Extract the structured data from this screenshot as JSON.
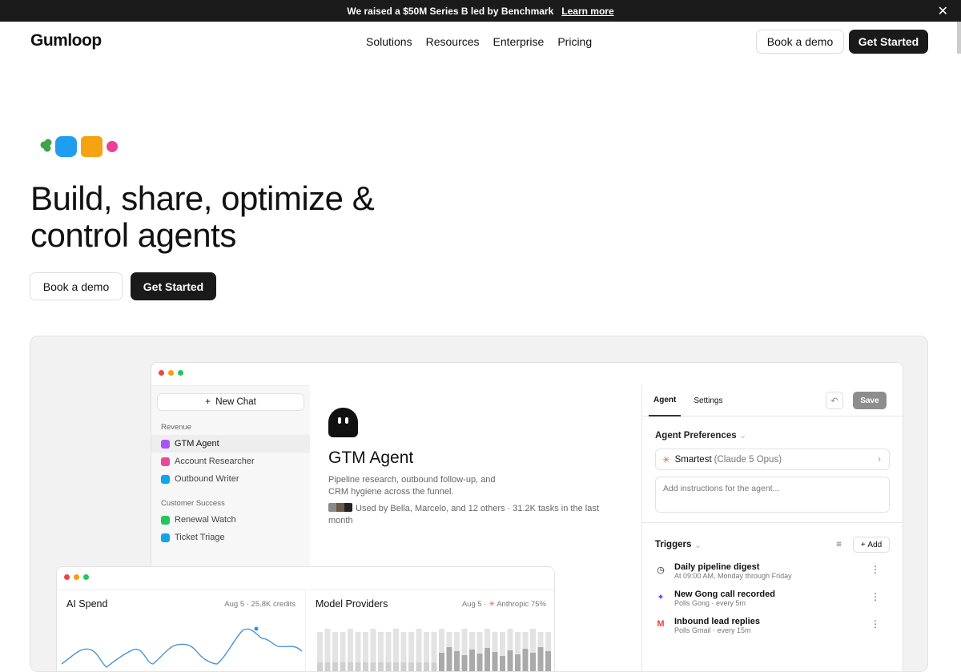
{
  "banner": {
    "text": "We raised a $50M Series B led by Benchmark",
    "link": "Learn more",
    "close": "✕"
  },
  "nav": {
    "logo": "Gumloop",
    "links": [
      "Solutions",
      "Resources",
      "Enterprise",
      "Pricing"
    ],
    "book_demo": "Book a demo",
    "get_started": "Get Started"
  },
  "hero": {
    "line1": "Build, share, optimize &",
    "line2": "control agents",
    "book_demo": "Book a demo",
    "get_started": "Get Started"
  },
  "app": {
    "new_chat": "New Chat",
    "groups": [
      {
        "label": "Revenue",
        "items": [
          {
            "label": "GTM Agent",
            "color": "#a855f7"
          },
          {
            "label": "Account Researcher",
            "color": "#ec4899"
          },
          {
            "label": "Outbound Writer",
            "color": "#0ea5e9"
          }
        ]
      },
      {
        "label": "Customer Success",
        "items": [
          {
            "label": "Renewal Watch",
            "color": "#22c55e"
          },
          {
            "label": "Ticket Triage",
            "color": "#0ea5e9"
          }
        ]
      }
    ],
    "agent": {
      "title": "GTM Agent",
      "desc": "Pipeline research, outbound follow-up, and CRM hygiene across the funnel.",
      "used": "Used by Bella, Marcelo, and 12 others · 31.2K tasks in the last month"
    },
    "tabs": [
      "Agent",
      "Settings"
    ],
    "save": "Save",
    "prefs": {
      "title": "Agent Preferences",
      "model_name": "Smartest",
      "model_detail": "(Claude 5 Opus)",
      "placeholder": "Add instructions for the agent..."
    },
    "triggers": {
      "title": "Triggers",
      "add": "Add",
      "items": [
        {
          "name": "Daily pipeline digest",
          "sub": "At 09:00 AM, Monday through Friday",
          "icon": "clock-icon"
        },
        {
          "name": "New Gong call recorded",
          "sub": "Polls Gong · every 5m",
          "icon": "gong-icon"
        },
        {
          "name": "Inbound lead replies",
          "sub": "Polls Gmail · every 15m",
          "icon": "gmail-icon"
        }
      ]
    }
  },
  "dashboard": {
    "ai_spend": {
      "title": "AI Spend",
      "meta": "Aug 5 · 25.8K credits"
    },
    "providers": {
      "title": "Model Providers",
      "meta_date": "Aug 5 ·",
      "meta_provider": "Anthropic 75%"
    }
  }
}
